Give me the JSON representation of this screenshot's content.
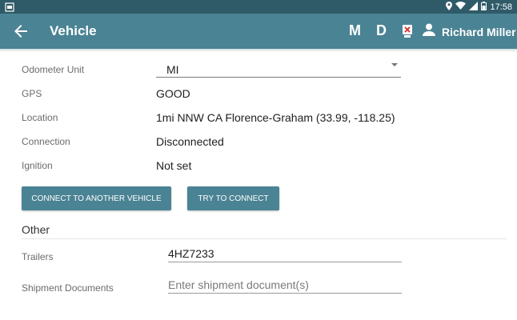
{
  "status_bar": {
    "time": "17:58",
    "icons": [
      "screenshot-icon",
      "location-icon",
      "wifi-icon",
      "signal-icon",
      "battery-icon"
    ]
  },
  "app_bar": {
    "title": "Vehicle",
    "back_icon": "arrow-back-icon",
    "action_m": "M",
    "action_d": "D",
    "inspection_icon": "inspection-report-icon",
    "user_icon": "person-icon",
    "user_name": "Richard Miller"
  },
  "fields": {
    "odometer_unit": {
      "label": "Odometer Unit",
      "value": "MI"
    },
    "gps": {
      "label": "GPS",
      "value": "GOOD"
    },
    "location": {
      "label": "Location",
      "value": "1mi NNW CA Florence-Graham (33.99, -118.25)"
    },
    "connection": {
      "label": "Connection",
      "value": "Disconnected"
    },
    "ignition": {
      "label": "Ignition",
      "value": "Not set"
    }
  },
  "buttons": {
    "connect_another": "CONNECT TO ANOTHER VEHICLE",
    "try_connect": "TRY TO CONNECT"
  },
  "other": {
    "section_title": "Other",
    "trailers": {
      "label": "Trailers",
      "value": "4HZ7233"
    },
    "shipment_documents": {
      "label": "Shipment Documents",
      "value": "",
      "placeholder": "Enter shipment document(s)"
    }
  },
  "colors": {
    "app_bar": "#4a8394",
    "status_bar": "#2f5a68",
    "button": "#4a8394"
  }
}
